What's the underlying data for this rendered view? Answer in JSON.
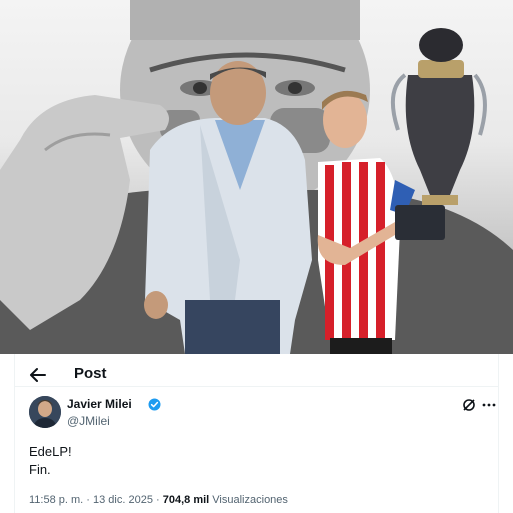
{
  "header": {
    "title": "Post"
  },
  "post": {
    "author_name": "Javier Milei",
    "author_handle": "@JMilei",
    "text_lines": [
      "EdeLP!",
      "Fin."
    ],
    "time": "11:58 p. m.",
    "date": "13 dic. 2025",
    "views_count": "704,8 mil",
    "views_label": "Visualizaciones",
    "separator": "·"
  },
  "icons": {
    "back": "arrow-left-icon",
    "verified": "verified-badge-icon",
    "grok": "grok-icon",
    "more": "more-horizontal-icon"
  },
  "colors": {
    "text": "#0f1419",
    "secondary": "#536471",
    "verified_blue": "#1d9bf0",
    "border": "#eff3f4",
    "jersey_red": "#d6202a"
  }
}
